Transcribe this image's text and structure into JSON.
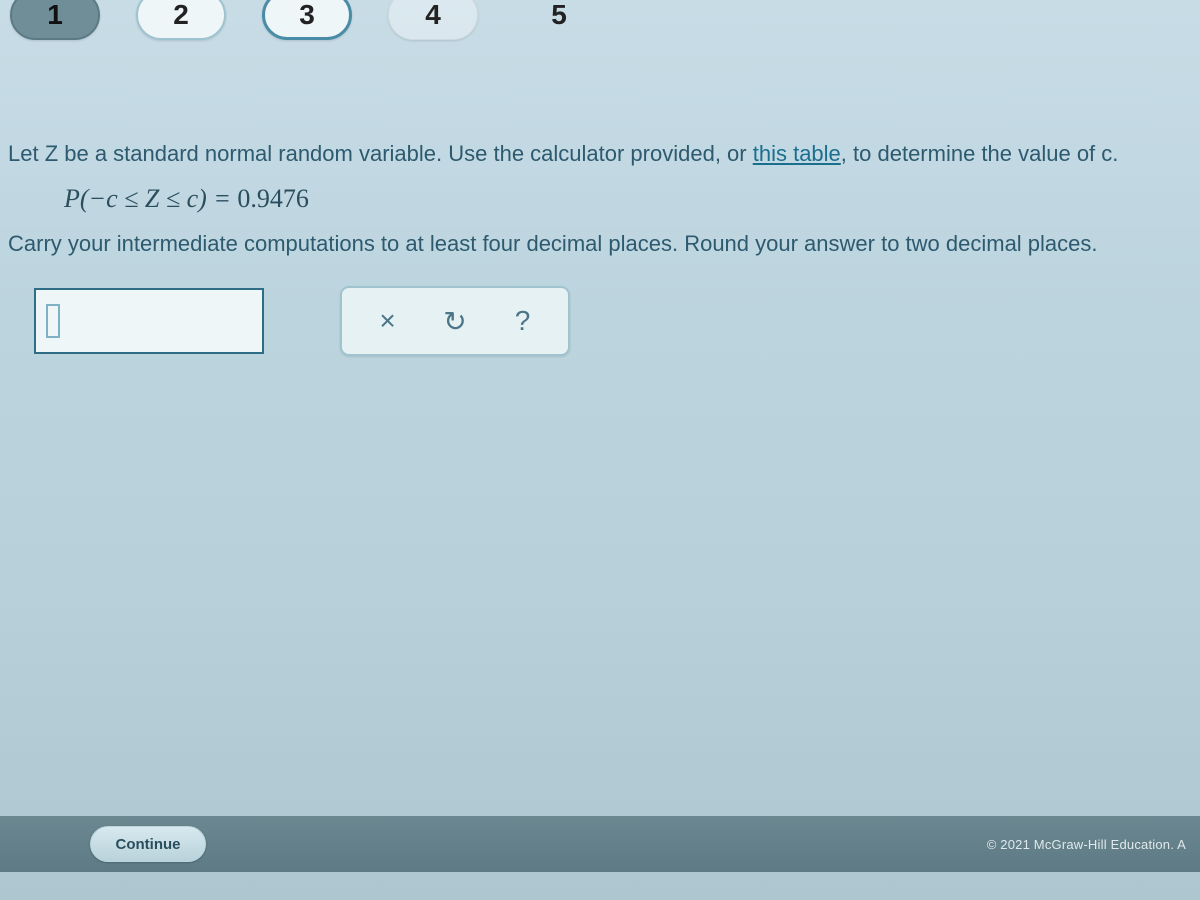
{
  "nav": {
    "items": [
      {
        "label": "1",
        "style": "active"
      },
      {
        "label": "2",
        "style": "plain"
      },
      {
        "label": "3",
        "style": "outlined"
      },
      {
        "label": "4",
        "style": "faded"
      },
      {
        "label": "5",
        "style": "ghost"
      }
    ]
  },
  "question": {
    "intro_before_link": "Let Z be a standard normal random variable. Use the calculator provided, or ",
    "link_text": "this table",
    "intro_after_link": ", to determine the value of c.",
    "formula_lhs": "P(−c ≤ Z ≤ c)",
    "formula_eq": " = ",
    "formula_rhs": "0.9476",
    "instruction": "Carry your intermediate computations to at least four decimal places. Round your answer to two decimal places."
  },
  "answer": {
    "value": ""
  },
  "toolbar": {
    "clear_icon": "×",
    "reset_icon": "↻",
    "help_icon": "?"
  },
  "footer": {
    "continue_label": "Continue",
    "copyright": "© 2021 McGraw-Hill Education. A"
  }
}
